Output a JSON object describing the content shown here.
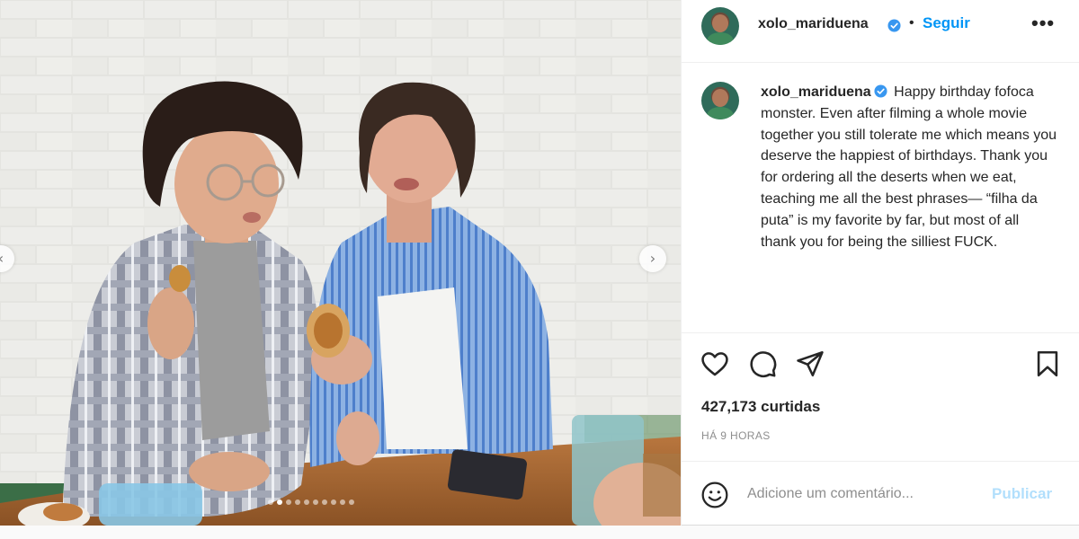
{
  "post": {
    "username": "xolo_mariduena",
    "verified": true,
    "follow_label": "Seguir",
    "more_label": "•••",
    "separator": "•",
    "caption_text": "Happy birthday fofoca monster. Even after filming a whole movie together you still tolerate me which means you deserve the happiest of birthdays. Thank you for ordering all the deserts when we eat, teaching me all the best phrases— “filha da puta” is my favorite by far, but most of all thank you for being the silliest FUCK.",
    "likes_text": "427,173 curtidas",
    "time_text": "HÁ 9 HORAS",
    "comment_placeholder": "Adicione um comentário...",
    "publish_label": "Publicar",
    "carousel": {
      "total_slides": 10,
      "active_slide": 2
    }
  },
  "icons": {
    "like": "heart-icon",
    "comment": "comment-icon",
    "share": "share-icon",
    "save": "bookmark-icon",
    "emoji": "emoji-icon",
    "verified": "verified-badge-icon",
    "prev": "chevron-left-icon",
    "next": "chevron-right-icon"
  },
  "colors": {
    "link_blue": "#0095f6",
    "publish_disabled": "#b2dffc",
    "verified_blue": "#3897f0",
    "text_primary": "#262626",
    "text_secondary": "#8e8e8e"
  }
}
